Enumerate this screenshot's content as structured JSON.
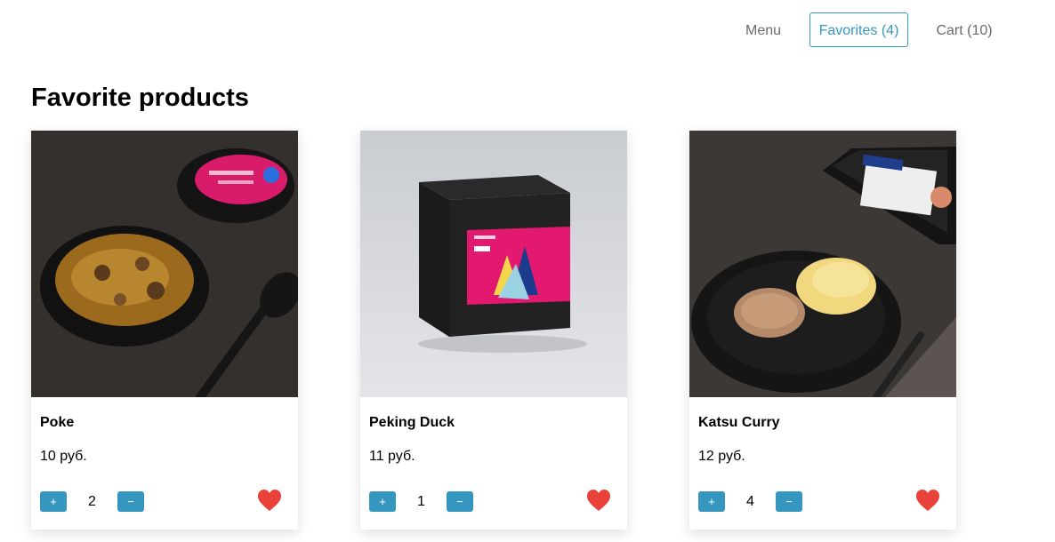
{
  "nav": {
    "menu_label": "Menu",
    "favorites_label": "Favorites (4)",
    "cart_label": "Cart (10)"
  },
  "page": {
    "title": "Favorite products"
  },
  "accent_color": "#3597bf",
  "heart_color": "#e8423a",
  "products": [
    {
      "name": "Poke",
      "price": "10 руб.",
      "quantity": "2",
      "plus": "+",
      "minus": "−",
      "favorite": true
    },
    {
      "name": "Peking Duck",
      "price": "11 руб.",
      "quantity": "1",
      "plus": "+",
      "minus": "−",
      "favorite": true
    },
    {
      "name": "Katsu Curry",
      "price": "12 руб.",
      "quantity": "4",
      "plus": "+",
      "minus": "−",
      "favorite": true
    }
  ]
}
